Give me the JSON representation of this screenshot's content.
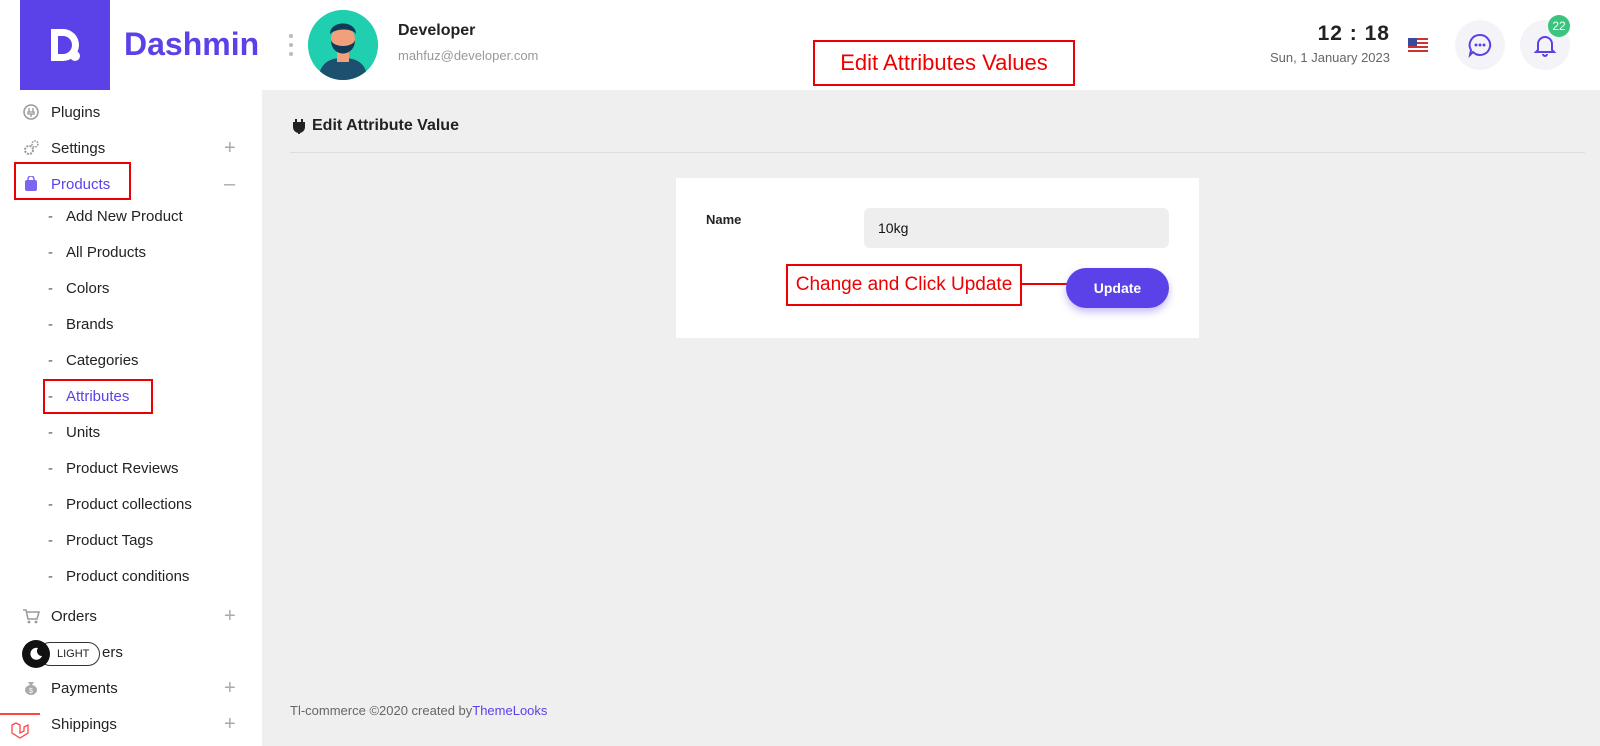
{
  "header": {
    "brand": "Dashmin",
    "user_name": "Developer",
    "user_email": "mahfuz@developer.com",
    "clock": "12 : 18",
    "date": "Sun, 1 January 2023",
    "notification_count": "22",
    "annotation": "Edit Attributes Values"
  },
  "sidebar": {
    "plugins": "Plugins",
    "settings": "Settings",
    "products": "Products",
    "sub": {
      "add_new": "Add New Product",
      "all_products": "All Products",
      "colors": "Colors",
      "brands": "Brands",
      "categories": "Categories",
      "attributes": "Attributes",
      "units": "Units",
      "reviews": "Product Reviews",
      "collections": "Product collections",
      "tags": "Product Tags",
      "conditions": "Product conditions"
    },
    "orders": "Orders",
    "customers_partial": "ers",
    "payments": "Payments",
    "shippings": "Shippings",
    "theme_toggle": "LIGHT",
    "expand_symbol": "+",
    "collapse_symbol": "–",
    "dash": "-"
  },
  "main": {
    "title": "Edit Attribute Value",
    "name_label": "Name",
    "name_value": "10kg",
    "update_label": "Update",
    "annotation": "Change and Click Update"
  },
  "footer": {
    "text": "Tl-commerce ©2020 created by",
    "link": "ThemeLooks"
  },
  "colors": {
    "accent": "#5b42e8",
    "annotation": "#ee0000",
    "badge": "#3ac47d"
  }
}
